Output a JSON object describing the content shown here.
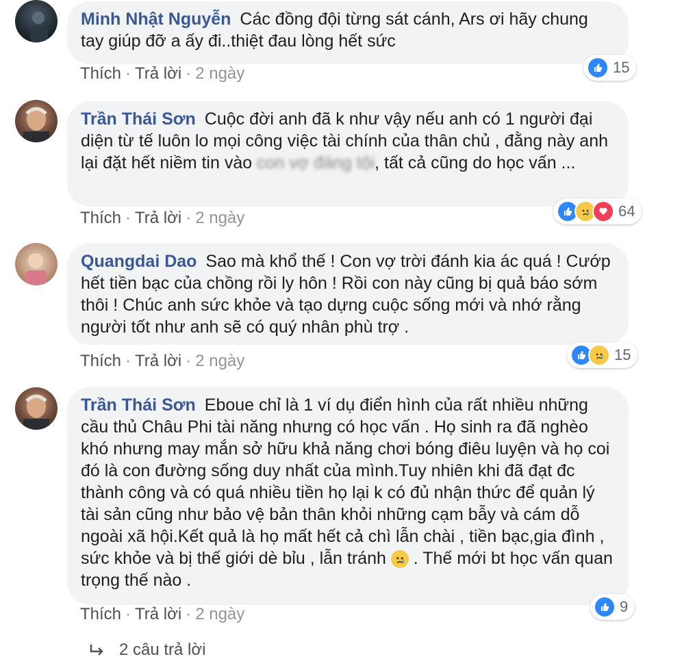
{
  "comments": [
    {
      "author": "Minh Nhật Nguyễn",
      "text": "Các đồng đội từng sát cánh, Ars ơi hãy chung tay giúp đỡ a ấy đi..thiệt đau lòng hết sức",
      "actions": {
        "like": "Thích",
        "reply": "Trả lời",
        "time": "2 ngày"
      },
      "reaction_count": "15",
      "reaction_icons": [
        "like-icon"
      ]
    },
    {
      "author": "Trần Thái Sơn",
      "text_parts": [
        "Cuộc đời anh đã k như vậy nếu anh có 1 người đại diện từ tế luôn lo mọi công việc tài chính của thân chủ , đằng này anh lại đặt hết niềm tin vào ",
        "con vợ ",
        "đáng tội",
        ", tất cả cũng do học vấn ..."
      ],
      "actions": {
        "like": "Thích",
        "reply": "Trả lời",
        "time": "2 ngày"
      },
      "reaction_count": "64",
      "reaction_icons": [
        "like-icon",
        "sad-icon",
        "love-icon"
      ]
    },
    {
      "author": "Quangdai Dao",
      "text": "Sao mà khổ thế ! Con vợ trời đánh kia ác quá ! Cướp hết tiền bạc của chồng rồi ly hôn ! Rồi con này cũng bị quả báo sớm thôi ! Chúc anh sức khỏe và tạo dựng cuộc sống mới và nhớ rằng người tốt như anh sẽ có quý nhân phù trợ .",
      "actions": {
        "like": "Thích",
        "reply": "Trả lời",
        "time": "2 ngày"
      },
      "reaction_count": "15",
      "reaction_icons": [
        "like-icon",
        "sad-icon"
      ]
    },
    {
      "author": "Trần Thái Sơn",
      "text_before": "Eboue chỉ là 1 ví dụ điển hình của rất nhiều những cầu thủ Châu Phi tài năng nhưng có học vấn . Họ sinh ra đã nghèo khó nhưng may mắn sở hữu khả năng chơi bóng điêu luyện và họ coi đó là con đường sống duy nhất của mình.Tuy nhiên khi đã đạt đc thành công và có quá nhiều tiền họ lại k có đủ nhận thức để quản lý tài sản cũng như bảo vệ bản thân khỏi những cạm bẫy và cám dỗ ngoài xã hội.Kết quả là họ mất hết cả chì lẫn chài , tiền bạc,gia đình , sức khỏe và bị thế giới dè bỉu , lẫn tránh ",
      "text_after": " . Thế mới bt học vấn quan trọng thế nào .",
      "actions": {
        "like": "Thích",
        "reply": "Trả lời",
        "time": "2 ngày"
      },
      "reaction_count": "9",
      "reaction_icons": [
        "like-icon"
      ]
    }
  ],
  "replies_link": "2 câu trả lời",
  "colors": {
    "author": "#385898",
    "bubble": "#f2f3f5",
    "like": "#2d88ff",
    "sad": "#f7c948",
    "love": "#f33e58"
  }
}
